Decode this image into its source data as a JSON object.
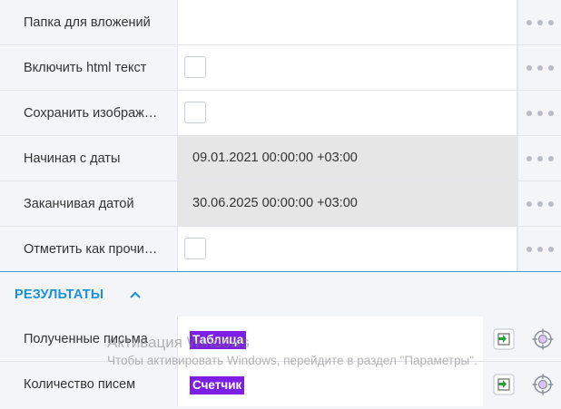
{
  "settings": {
    "rows": [
      {
        "label": "Папка для вложений",
        "type": "text",
        "value": ""
      },
      {
        "label": "Включить html текст",
        "type": "checkbox",
        "checked": false
      },
      {
        "label": "Сохранить изображ…",
        "type": "checkbox",
        "checked": false
      },
      {
        "label": "Начиная с даты",
        "type": "readonly",
        "value": "09.01.2021 00:00:00 +03:00"
      },
      {
        "label": "Заканчивая датой",
        "type": "readonly",
        "value": "30.06.2025 00:00:00 +03:00"
      },
      {
        "label": "Отметить как прочи…",
        "type": "checkbox",
        "checked": false
      }
    ]
  },
  "results": {
    "title": "РЕЗУЛЬТАТЫ",
    "rows": [
      {
        "label": "Полученные письма",
        "tag": "Таблица"
      },
      {
        "label": "Количество писем",
        "tag": "Счетчик"
      }
    ]
  },
  "watermark": {
    "title": "Активация Windows",
    "subtitle": "Чтобы активировать Windows, перейдите в раздел \"Параметры\"."
  },
  "colors": {
    "accent": "#1e90d8",
    "tag": "#7b1fe4",
    "readonly_bg": "#e6e6e6",
    "panel_bg": "#f4f5f8"
  },
  "icons": {
    "row_menu": "more-dots-icon",
    "section_toggle": "chevron-up-icon",
    "result_action_1": "green-arrow-box-icon",
    "result_action_2": "crosshair-target-icon"
  }
}
